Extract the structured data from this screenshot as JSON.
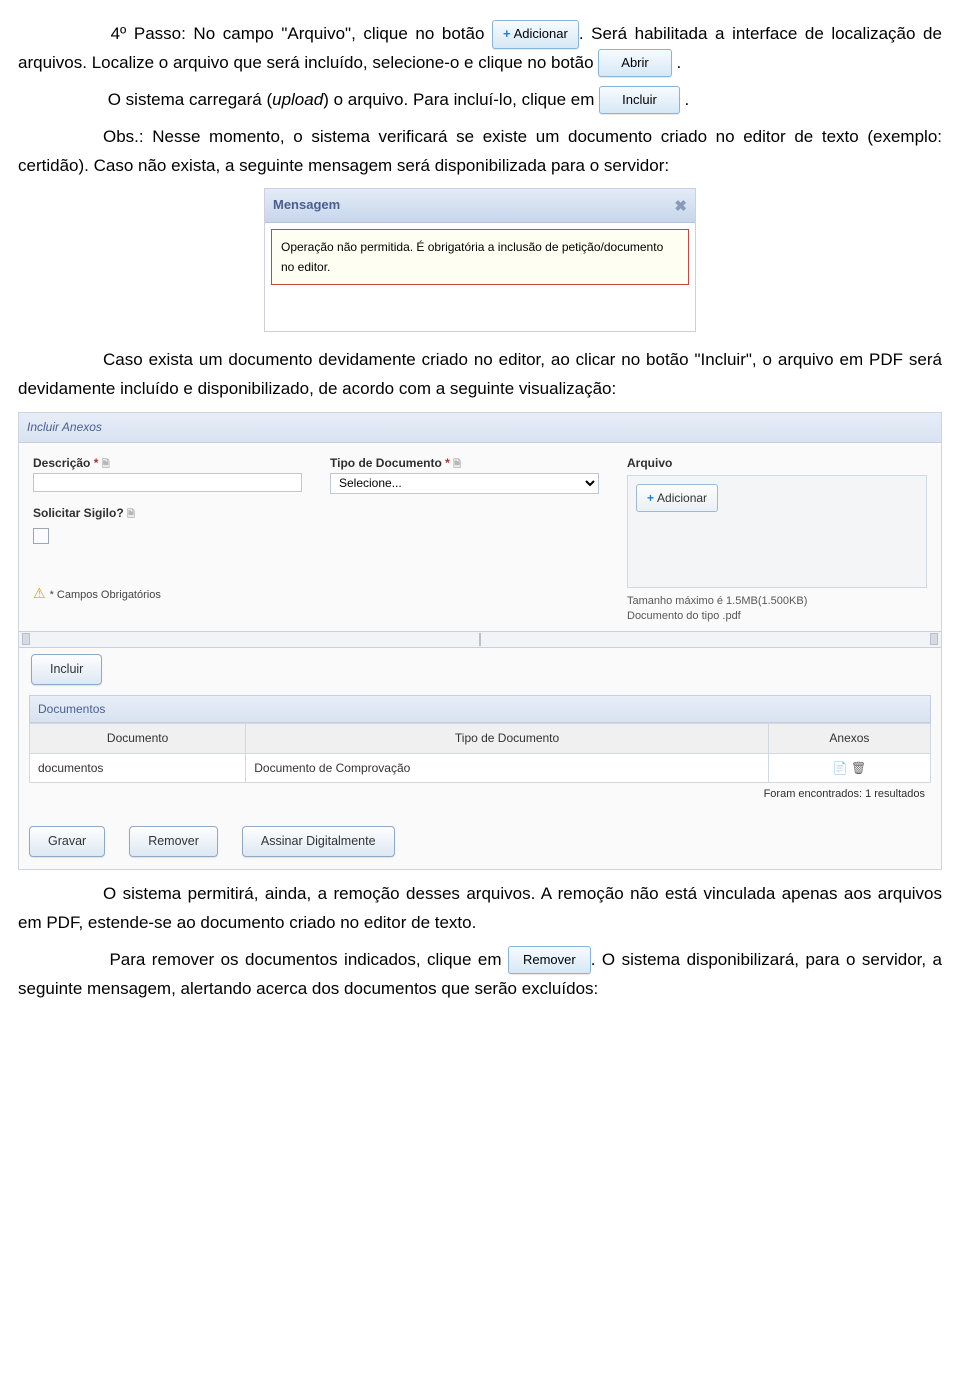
{
  "paragraphs": {
    "p1a": "4º Passo:  No campo \"Arquivo\", clique no  botão",
    "p1b": ". Será habilitada a interface de localização de arquivos. Localize o arquivo que será incluído, selecione-o e clique no botão",
    "p2a": "O sistema carregará (",
    "p2_upload": "upload",
    "p2b": ") o arquivo. Para incluí-lo, clique em",
    "p3": "Obs.: Nesse momento, o sistema verificará se existe um documento criado no editor de texto (exemplo: certidão). Caso não exista, a seguinte mensagem será disponibilizada para o servidor:",
    "p4": "Caso exista um documento devidamente criado no editor, ao clicar no botão \"Incluir\", o arquivo em PDF será devidamente incluído e disponibilizado, de acordo com a seguinte visualização:",
    "p5": "O sistema permitirá, ainda, a remoção desses arquivos.  A remoção não está vinculada apenas aos arquivos em PDF,  estende-se ao documento criado no editor de texto.",
    "p6a": "Para remover os documentos indicados, clique em",
    "p6b": ". O sistema disponibilizará, para o servidor, a seguinte mensagem, alertando acerca dos documentos que serão excluídos:"
  },
  "buttons": {
    "adicionar": "Adicionar",
    "abrir": "Abrir",
    "incluir": "Incluir",
    "gravar": "Gravar",
    "remover": "Remover",
    "assinar": "Assinar Digitalmente"
  },
  "mensagem": {
    "title": "Mensagem",
    "body": "Operação não permitida. É obrigatória a inclusão de petição/documento no editor."
  },
  "panel": {
    "title": "Incluir Anexos",
    "labels": {
      "descricao": "Descrição",
      "tipo": "Tipo de Documento",
      "arquivo": "Arquivo",
      "sigilo": "Solicitar Sigilo?"
    },
    "select_placeholder": "Selecione...",
    "hint1": "Tamanho máximo é 1.5MB(1.500KB)",
    "hint2": "Documento do tipo .pdf",
    "req_note": "* Campos Obrigatórios",
    "docs_title": "Documentos",
    "table": {
      "th1": "Documento",
      "th2": "Tipo de Documento",
      "th3": "Anexos",
      "row": {
        "c1": "documentos",
        "c2": "Documento de Comprovação"
      }
    },
    "result_count": "Foram encontrados: 1 resultados"
  }
}
